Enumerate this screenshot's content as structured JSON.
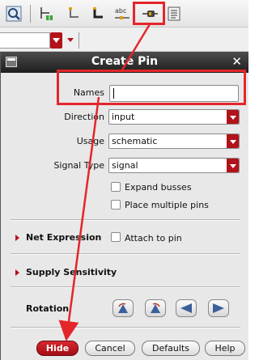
{
  "toolbar": {
    "icons": [
      "zoom-fit-icon",
      "add-component-icon",
      "wire-narrow-icon",
      "wire-wide-icon",
      "label-abc-icon",
      "create-pin-icon",
      "properties-icon"
    ],
    "label_icon_text": "abc"
  },
  "dialog": {
    "title": "Create Pin",
    "names_label": "Names",
    "names_value": "",
    "direction_label": "Direction",
    "direction_value": "input",
    "usage_label": "Usage",
    "usage_value": "schematic",
    "signal_type_label": "Signal Type",
    "signal_type_value": "signal",
    "expand_busses": "Expand busses",
    "place_multiple": "Place multiple pins",
    "net_expression": "Net Expression",
    "attach_to_pin": "Attach to pin",
    "supply_sensitivity": "Supply Sensitivity",
    "rotation": "Rotation",
    "buttons": {
      "hide": "Hide",
      "cancel": "Cancel",
      "defaults": "Defaults",
      "help": "Help"
    }
  },
  "colors": {
    "highlight": "#e3262a",
    "accent": "#b3121a",
    "titlebar": "#2a2a2a"
  }
}
